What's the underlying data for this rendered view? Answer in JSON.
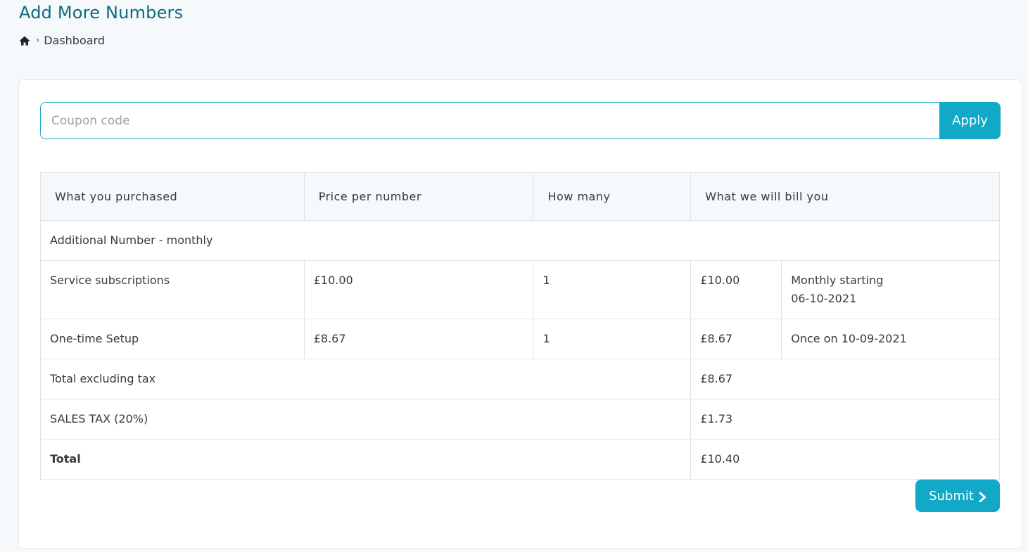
{
  "page": {
    "title": "Add More Numbers",
    "breadcrumb": {
      "home_icon": "home-icon",
      "separator": "›",
      "current": "Dashboard"
    }
  },
  "coupon": {
    "placeholder": "Coupon code",
    "value": "",
    "apply_label": "Apply"
  },
  "table": {
    "headers": [
      "What you purchased",
      "Price per number",
      "How many",
      "What we will bill you"
    ],
    "section_label": "Additional Number - monthly",
    "items": [
      {
        "name": "Service subscriptions",
        "price": "£10.00",
        "qty": "1",
        "bill": "£10.00",
        "schedule_line1": "Monthly starting",
        "schedule_line2": "06-10-2021"
      },
      {
        "name": "One-time Setup",
        "price": "£8.67",
        "qty": "1",
        "bill": "£8.67",
        "schedule_line1": "Once on 10-09-2021",
        "schedule_line2": ""
      }
    ],
    "subtotal": {
      "label": "Total excluding tax",
      "value": "£8.67"
    },
    "tax": {
      "label": "SALES TAX (20%)",
      "value": "£1.73"
    },
    "total": {
      "label": "Total",
      "value": "£10.40"
    }
  },
  "submit": {
    "label": "Submit",
    "icon": "chevron-right-icon"
  },
  "colors": {
    "accent": "#12a8c8",
    "title": "#0e6a80",
    "background": "#f5f9fc"
  }
}
